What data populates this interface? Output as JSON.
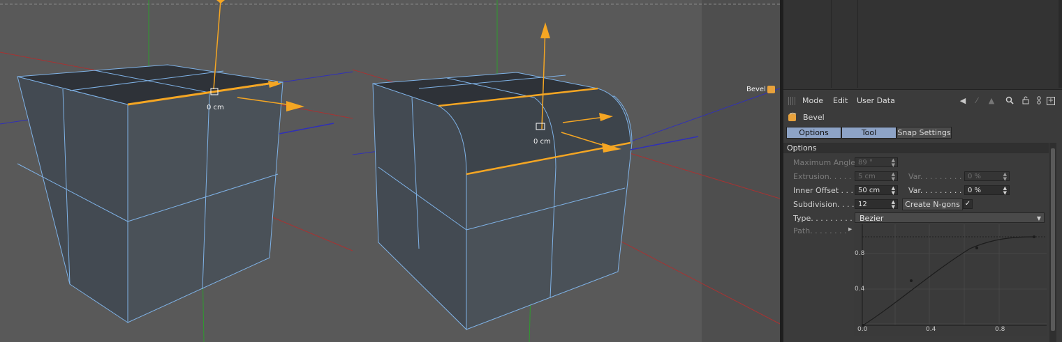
{
  "viewport": {
    "distance_label_left": "0 cm",
    "distance_label_right": "0 cm",
    "object_tag": "Bevel"
  },
  "menubar": {
    "items": [
      "Mode",
      "Edit",
      "User Data"
    ],
    "icons": [
      "arrow-left-icon",
      "arrow-up-icon",
      "arrow-diagonal-icon",
      "search-icon",
      "lock-icon",
      "link-icon",
      "add-icon"
    ]
  },
  "object": {
    "name": "Bevel",
    "icon": "bevel-icon"
  },
  "tabs": {
    "options": "Options",
    "tool": "Tool",
    "snap": "Snap Settings"
  },
  "section": {
    "title": "Options"
  },
  "fields": {
    "max_angle_label": "Maximum Angle",
    "max_angle_value": "89 °",
    "extrusion_label": "Extrusion. . . . . .",
    "extrusion_value": "5 cm",
    "extrusion_var_label": "Var. . . . . . . . . .",
    "extrusion_var_value": "0 %",
    "inner_offset_label": "Inner Offset . . .",
    "inner_offset_value": "50 cm",
    "inner_offset_var_label": "Var. . . . . . . . . .",
    "inner_offset_var_value": "0 %",
    "subdivision_label": "Subdivision. . . .",
    "subdivision_value": "12",
    "create_ngons_label": "Create N-gons",
    "create_ngons_checked": "✓",
    "type_label": "Type. . . . . . . . .",
    "type_value": "Bezier",
    "path_label": "Path. . . . . . . ."
  },
  "graph": {
    "y_ticks": [
      "0.8",
      "0.4"
    ],
    "x_ticks": [
      "0.0",
      "0.4",
      "0.8"
    ]
  },
  "colors": {
    "highlight_orange": "#f5a623",
    "wire_blue": "#7fb2e6",
    "tab_active": "#8da3c6"
  }
}
